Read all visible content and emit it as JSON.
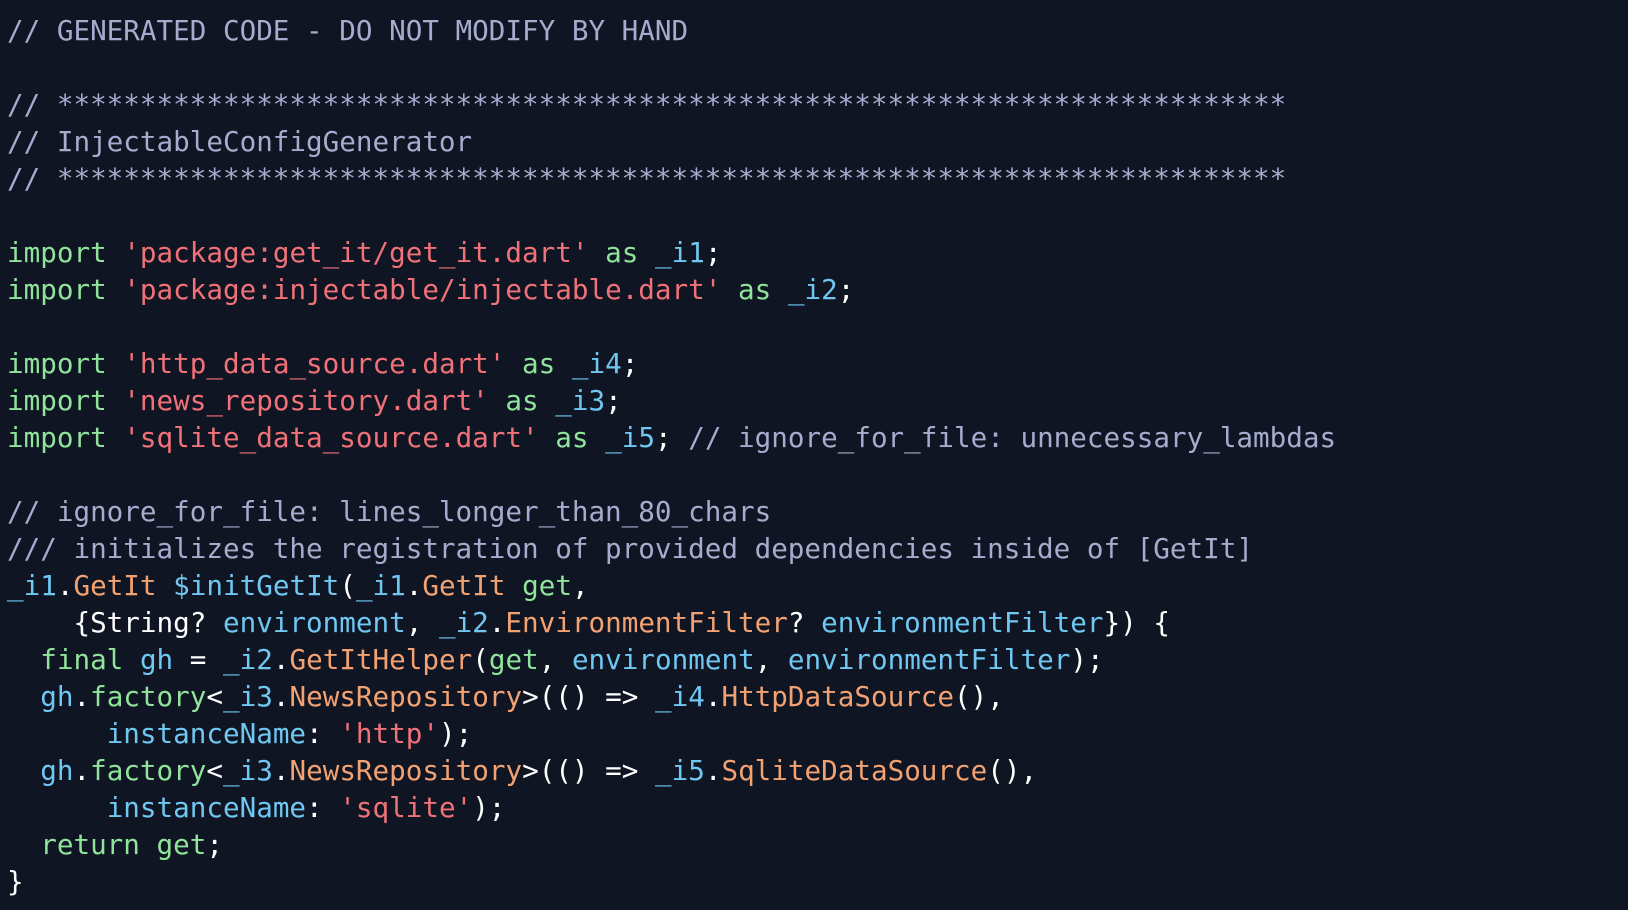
{
  "theme": {
    "background": "#0f1522",
    "colors": {
      "comment": "#a6accd",
      "keyword": "#8fe39a",
      "string": "#f07178",
      "ident": "#6fc7f2",
      "type": "#f2a272",
      "plain": "#ffffff"
    }
  },
  "editor": {
    "lines": [
      [
        {
          "t": "// GENERATED CODE - DO NOT MODIFY BY HAND",
          "c": "comment"
        }
      ],
      [],
      [
        {
          "t": "// **************************************************************************",
          "c": "comment"
        }
      ],
      [
        {
          "t": "// InjectableConfigGenerator",
          "c": "comment"
        }
      ],
      [
        {
          "t": "// **************************************************************************",
          "c": "comment"
        }
      ],
      [],
      [
        {
          "t": "import",
          "c": "keyword"
        },
        {
          "t": " ",
          "c": "plain"
        },
        {
          "t": "'package:get_it/get_it.dart'",
          "c": "string"
        },
        {
          "t": " ",
          "c": "plain"
        },
        {
          "t": "as",
          "c": "keyword"
        },
        {
          "t": " ",
          "c": "plain"
        },
        {
          "t": "_i1",
          "c": "ident"
        },
        {
          "t": ";",
          "c": "plain"
        }
      ],
      [
        {
          "t": "import",
          "c": "keyword"
        },
        {
          "t": " ",
          "c": "plain"
        },
        {
          "t": "'package:injectable/injectable.dart'",
          "c": "string"
        },
        {
          "t": " ",
          "c": "plain"
        },
        {
          "t": "as",
          "c": "keyword"
        },
        {
          "t": " ",
          "c": "plain"
        },
        {
          "t": "_i2",
          "c": "ident"
        },
        {
          "t": ";",
          "c": "plain"
        }
      ],
      [],
      [
        {
          "t": "import",
          "c": "keyword"
        },
        {
          "t": " ",
          "c": "plain"
        },
        {
          "t": "'http_data_source.dart'",
          "c": "string"
        },
        {
          "t": " ",
          "c": "plain"
        },
        {
          "t": "as",
          "c": "keyword"
        },
        {
          "t": " ",
          "c": "plain"
        },
        {
          "t": "_i4",
          "c": "ident"
        },
        {
          "t": ";",
          "c": "plain"
        }
      ],
      [
        {
          "t": "import",
          "c": "keyword"
        },
        {
          "t": " ",
          "c": "plain"
        },
        {
          "t": "'news_repository.dart'",
          "c": "string"
        },
        {
          "t": " ",
          "c": "plain"
        },
        {
          "t": "as",
          "c": "keyword"
        },
        {
          "t": " ",
          "c": "plain"
        },
        {
          "t": "_i3",
          "c": "ident"
        },
        {
          "t": ";",
          "c": "plain"
        }
      ],
      [
        {
          "t": "import",
          "c": "keyword"
        },
        {
          "t": " ",
          "c": "plain"
        },
        {
          "t": "'sqlite_data_source.dart'",
          "c": "string"
        },
        {
          "t": " ",
          "c": "plain"
        },
        {
          "t": "as",
          "c": "keyword"
        },
        {
          "t": " ",
          "c": "plain"
        },
        {
          "t": "_i5",
          "c": "ident"
        },
        {
          "t": "; ",
          "c": "plain"
        },
        {
          "t": "// ignore_for_file: unnecessary_lambdas",
          "c": "comment"
        }
      ],
      [],
      [
        {
          "t": "// ignore_for_file: lines_longer_than_80_chars",
          "c": "comment"
        }
      ],
      [
        {
          "t": "/// initializes the registration of provided dependencies inside of [GetIt]",
          "c": "comment"
        }
      ],
      [
        {
          "t": "_i1",
          "c": "ident"
        },
        {
          "t": ".",
          "c": "plain"
        },
        {
          "t": "GetIt",
          "c": "type"
        },
        {
          "t": " ",
          "c": "plain"
        },
        {
          "t": "$initGetIt",
          "c": "ident"
        },
        {
          "t": "(",
          "c": "plain"
        },
        {
          "t": "_i1",
          "c": "ident"
        },
        {
          "t": ".",
          "c": "plain"
        },
        {
          "t": "GetIt",
          "c": "type"
        },
        {
          "t": " ",
          "c": "plain"
        },
        {
          "t": "get",
          "c": "keyword"
        },
        {
          "t": ",",
          "c": "plain"
        }
      ],
      [
        {
          "t": "    {String? ",
          "c": "plain"
        },
        {
          "t": "environment",
          "c": "ident"
        },
        {
          "t": ", ",
          "c": "plain"
        },
        {
          "t": "_i2",
          "c": "ident"
        },
        {
          "t": ".",
          "c": "plain"
        },
        {
          "t": "EnvironmentFilter",
          "c": "type"
        },
        {
          "t": "? ",
          "c": "plain"
        },
        {
          "t": "environmentFilter",
          "c": "ident"
        },
        {
          "t": "}) {",
          "c": "plain"
        }
      ],
      [
        {
          "t": "  ",
          "c": "plain"
        },
        {
          "t": "final",
          "c": "keyword"
        },
        {
          "t": " ",
          "c": "plain"
        },
        {
          "t": "gh",
          "c": "ident"
        },
        {
          "t": " = ",
          "c": "plain"
        },
        {
          "t": "_i2",
          "c": "ident"
        },
        {
          "t": ".",
          "c": "plain"
        },
        {
          "t": "GetItHelper",
          "c": "type"
        },
        {
          "t": "(",
          "c": "plain"
        },
        {
          "t": "get",
          "c": "keyword"
        },
        {
          "t": ", ",
          "c": "plain"
        },
        {
          "t": "environment",
          "c": "ident"
        },
        {
          "t": ", ",
          "c": "plain"
        },
        {
          "t": "environmentFilter",
          "c": "ident"
        },
        {
          "t": ");",
          "c": "plain"
        }
      ],
      [
        {
          "t": "  ",
          "c": "plain"
        },
        {
          "t": "gh",
          "c": "ident"
        },
        {
          "t": ".",
          "c": "plain"
        },
        {
          "t": "factory",
          "c": "keyword"
        },
        {
          "t": "<",
          "c": "plain"
        },
        {
          "t": "_i3",
          "c": "ident"
        },
        {
          "t": ".",
          "c": "plain"
        },
        {
          "t": "NewsRepository",
          "c": "type"
        },
        {
          "t": ">(() => ",
          "c": "plain"
        },
        {
          "t": "_i4",
          "c": "ident"
        },
        {
          "t": ".",
          "c": "plain"
        },
        {
          "t": "HttpDataSource",
          "c": "type"
        },
        {
          "t": "(),",
          "c": "plain"
        }
      ],
      [
        {
          "t": "      ",
          "c": "plain"
        },
        {
          "t": "instanceName",
          "c": "ident"
        },
        {
          "t": ": ",
          "c": "plain"
        },
        {
          "t": "'http'",
          "c": "string"
        },
        {
          "t": ");",
          "c": "plain"
        }
      ],
      [
        {
          "t": "  ",
          "c": "plain"
        },
        {
          "t": "gh",
          "c": "ident"
        },
        {
          "t": ".",
          "c": "plain"
        },
        {
          "t": "factory",
          "c": "keyword"
        },
        {
          "t": "<",
          "c": "plain"
        },
        {
          "t": "_i3",
          "c": "ident"
        },
        {
          "t": ".",
          "c": "plain"
        },
        {
          "t": "NewsRepository",
          "c": "type"
        },
        {
          "t": ">(() => ",
          "c": "plain"
        },
        {
          "t": "_i5",
          "c": "ident"
        },
        {
          "t": ".",
          "c": "plain"
        },
        {
          "t": "SqliteDataSource",
          "c": "type"
        },
        {
          "t": "(),",
          "c": "plain"
        }
      ],
      [
        {
          "t": "      ",
          "c": "plain"
        },
        {
          "t": "instanceName",
          "c": "ident"
        },
        {
          "t": ": ",
          "c": "plain"
        },
        {
          "t": "'sqlite'",
          "c": "string"
        },
        {
          "t": ");",
          "c": "plain"
        }
      ],
      [
        {
          "t": "  ",
          "c": "plain"
        },
        {
          "t": "return",
          "c": "keyword"
        },
        {
          "t": " ",
          "c": "plain"
        },
        {
          "t": "get",
          "c": "keyword"
        },
        {
          "t": ";",
          "c": "plain"
        }
      ],
      [
        {
          "t": "}",
          "c": "plain"
        }
      ]
    ]
  }
}
